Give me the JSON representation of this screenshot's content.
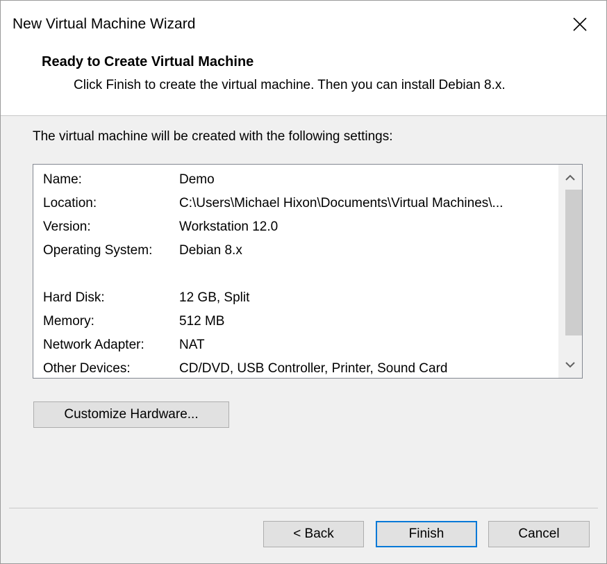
{
  "window": {
    "title": "New Virtual Machine Wizard"
  },
  "header": {
    "heading": "Ready to Create Virtual Machine",
    "subheading": "Click Finish to create the virtual machine. Then you can install Debian 8.x."
  },
  "main": {
    "intro": "The virtual machine will be created with the following settings:",
    "settings": [
      {
        "label": "Name:",
        "value": "Demo"
      },
      {
        "label": "Location:",
        "value": "C:\\Users\\Michael Hixon\\Documents\\Virtual Machines\\..."
      },
      {
        "label": "Version:",
        "value": "Workstation 12.0"
      },
      {
        "label": "Operating System:",
        "value": "Debian 8.x"
      },
      {
        "label": "Hard Disk:",
        "value": "12 GB, Split"
      },
      {
        "label": "Memory:",
        "value": "512 MB"
      },
      {
        "label": "Network Adapter:",
        "value": "NAT"
      },
      {
        "label": "Other Devices:",
        "value": "CD/DVD, USB Controller, Printer, Sound Card"
      }
    ],
    "customize_label": "Customize Hardware..."
  },
  "footer": {
    "back_label": "< Back",
    "finish_label": "Finish",
    "cancel_label": "Cancel"
  },
  "icons": {
    "close": "close-icon",
    "scroll_up": "chevron-up-icon",
    "scroll_down": "chevron-down-icon"
  },
  "colors": {
    "focus_border": "#0078d7",
    "dialog_bg": "#f0f0f0",
    "header_bg": "#ffffff"
  }
}
